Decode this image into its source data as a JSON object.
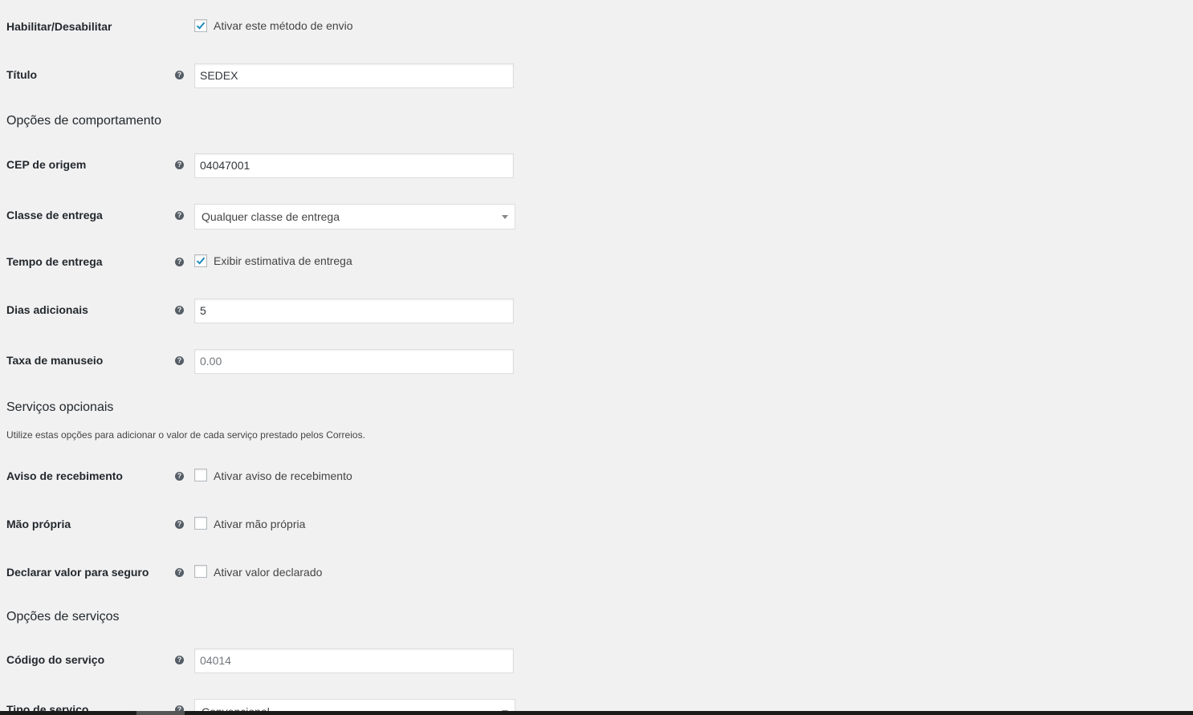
{
  "enable": {
    "label": "Habilitar/Desabilitar",
    "checkbox_label": "Ativar este método de envio",
    "checked": true
  },
  "title_field": {
    "label": "Título",
    "value": "SEDEX"
  },
  "behavior_section": {
    "title": "Opções de comportamento"
  },
  "cep": {
    "label": "CEP de origem",
    "value": "04047001"
  },
  "shipping_class": {
    "label": "Classe de entrega",
    "selected": "Qualquer classe de entrega"
  },
  "delivery_time": {
    "label": "Tempo de entrega",
    "checkbox_label": "Exibir estimativa de entrega",
    "checked": true
  },
  "additional_days": {
    "label": "Dias adicionais",
    "value": "5"
  },
  "handling_fee": {
    "label": "Taxa de manuseio",
    "placeholder": "0.00"
  },
  "optional_section": {
    "title": "Serviços opcionais",
    "description": "Utilize estas opções para adicionar o valor de cada serviço prestado pelos Correios."
  },
  "receipt_notice": {
    "label": "Aviso de recebimento",
    "checkbox_label": "Ativar aviso de recebimento",
    "checked": false
  },
  "own_hand": {
    "label": "Mão própria",
    "checkbox_label": "Ativar mão própria",
    "checked": false
  },
  "declared_value": {
    "label": "Declarar valor para seguro",
    "checkbox_label": "Ativar valor declarado",
    "checked": false
  },
  "services_section": {
    "title": "Opções de serviços"
  },
  "service_code": {
    "label": "Código do serviço",
    "placeholder": "04014"
  },
  "service_type": {
    "label": "Tipo de serviço",
    "selected": "Convencional"
  },
  "icons": {
    "help": "help-tip-icon",
    "check": "checkmark-icon",
    "caret": "chevron-down-icon"
  },
  "colors": {
    "background": "#f1f1f1",
    "check": "#1e8cbe",
    "help_icon": "#555d66"
  }
}
